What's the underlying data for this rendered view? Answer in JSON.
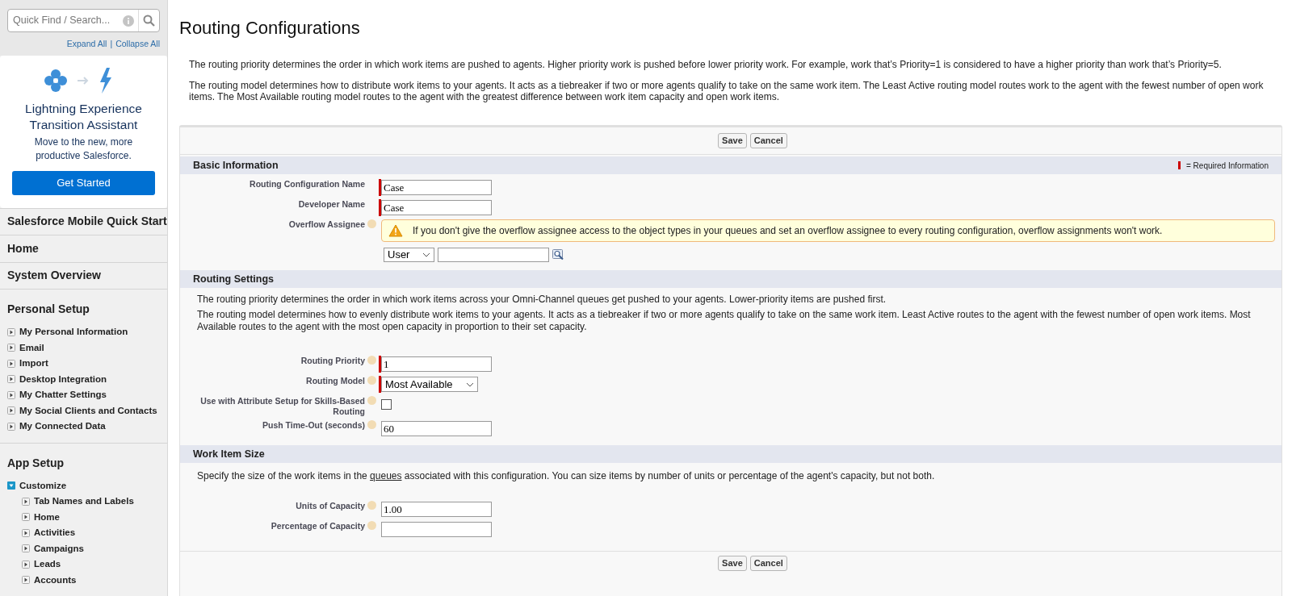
{
  "sidebar": {
    "search": {
      "placeholder": "Quick Find / Search..."
    },
    "expand_all": "Expand All",
    "separator": "|",
    "collapse_all": "Collapse All",
    "promo": {
      "title": "Lightning Experience Transition Assistant",
      "text": "Move to the new, more productive Salesforce.",
      "button": "Get Started"
    },
    "links": [
      {
        "label": "Salesforce Mobile Quick Start"
      },
      {
        "label": "Home"
      },
      {
        "label": "System Overview"
      }
    ],
    "groups": [
      {
        "title": "Personal Setup",
        "items": [
          {
            "label": "My Personal Information",
            "expanded": false
          },
          {
            "label": "Email",
            "expanded": false
          },
          {
            "label": "Import",
            "expanded": false
          },
          {
            "label": "Desktop Integration",
            "expanded": false
          },
          {
            "label": "My Chatter Settings",
            "expanded": false
          },
          {
            "label": "My Social Clients and Contacts",
            "expanded": false
          },
          {
            "label": "My Connected Data",
            "expanded": false
          }
        ]
      },
      {
        "title": "App Setup",
        "items": [
          {
            "label": "Customize",
            "expanded": true,
            "children": [
              {
                "label": "Tab Names and Labels",
                "expanded": false
              },
              {
                "label": "Home",
                "expanded": false
              },
              {
                "label": "Activities",
                "expanded": false
              },
              {
                "label": "Campaigns",
                "expanded": false
              },
              {
                "label": "Leads",
                "expanded": false
              },
              {
                "label": "Accounts",
                "expanded": false
              }
            ]
          }
        ]
      }
    ]
  },
  "page": {
    "title": "Routing Configurations",
    "intro": [
      "The routing priority determines the order in which work items are pushed to agents. Higher priority work is pushed before lower priority work. For example, work that’s Priority=1 is considered to have a higher priority than work that’s Priority=5.",
      "The routing model determines how to distribute work items to your agents. It acts as a tiebreaker if two or more agents qualify to take on the same work item. The Least Active routing model routes work to the agent with the fewest number of open work items. The Most Available routing model routes to the agent with the greatest difference between work item capacity and open work items."
    ]
  },
  "form": {
    "top_buttons": [
      "Save",
      "Cancel"
    ],
    "required_legend": "= Required Information",
    "bottom_buttons": [
      "Save",
      "Cancel"
    ],
    "sections": [
      {
        "title": "Basic Information",
        "fields": [
          {
            "kind": "text",
            "label": "Routing Configuration Name",
            "value": "Case",
            "required": true,
            "help": false
          },
          {
            "kind": "text",
            "label": "Developer Name",
            "value": "Case",
            "required": true,
            "help": false
          },
          {
            "kind": "lookup",
            "label": "Overflow Assignee",
            "help": true,
            "required": false,
            "warning": "If you don't give the overflow assignee access to the object types in your queues and set an overflow assignee to every routing configuration, overflow assignments won't work.",
            "type_value": "User"
          }
        ]
      },
      {
        "title": "Routing Settings",
        "notes": [
          {
            "text": "The routing priority determines the order in which work items across your Omni-Channel queues get pushed to your agents. Lower-priority items are pushed first."
          },
          {
            "text": "The routing model determines how to evenly distribute work items to your agents. It acts as a tiebreaker if two or more agents qualify to take on the same work item. Least Active routes to the agent with the fewest number of open work items. Most Available routes to the agent with the most open capacity in proportion to their set capacity."
          }
        ],
        "fields": [
          {
            "kind": "text",
            "label": "Routing Priority",
            "value": "1",
            "required": true,
            "help": true
          },
          {
            "kind": "select",
            "label": "Routing Model",
            "value": "Most Available",
            "required": true,
            "help": true
          },
          {
            "kind": "checkbox",
            "label": "Use with Attribute Setup for Skills-Based Routing",
            "checked": false,
            "required": false,
            "help": true
          },
          {
            "kind": "text",
            "label": "Push Time-Out (seconds)",
            "value": "60",
            "required": false,
            "help": true
          }
        ]
      },
      {
        "title": "Work Item Size",
        "notes": [
          {
            "text": "Specify the size of the work items in the",
            "link": "queues",
            "after": "associated with this configuration. You can size items by number of units or percentage of the agent's capacity, but not both."
          }
        ],
        "fields": [
          {
            "kind": "text",
            "label": "Units of Capacity",
            "value": "1.00",
            "required": false,
            "help": true
          },
          {
            "kind": "text",
            "label": "Percentage of Capacity",
            "required": false,
            "help": true
          }
        ]
      }
    ]
  }
}
